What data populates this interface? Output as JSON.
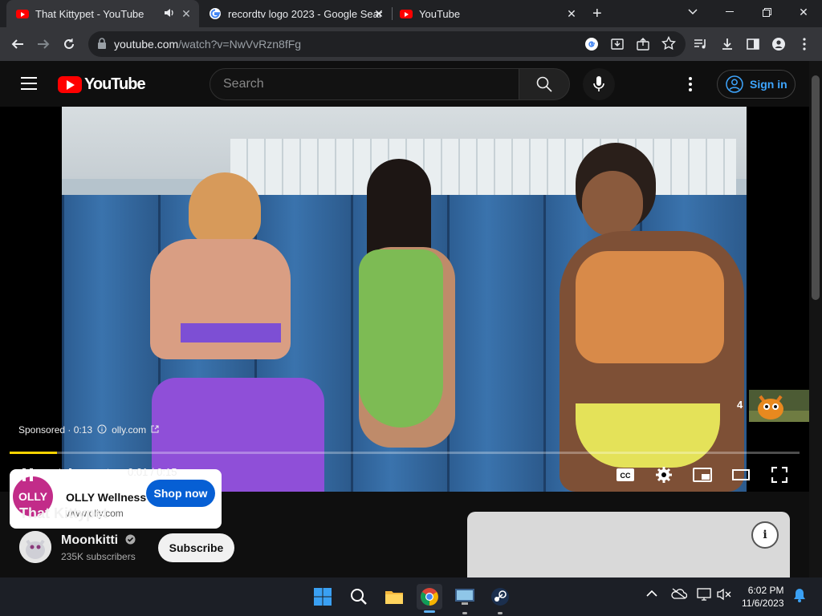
{
  "browser": {
    "tabs": [
      {
        "title": "That Kittypet - YouTube",
        "favicon": "youtube-icon",
        "active": true,
        "audio": true
      },
      {
        "title": "recordtv logo 2023 - Google Sear",
        "favicon": "google-icon",
        "active": false
      },
      {
        "title": "YouTube",
        "favicon": "youtube-icon",
        "active": false
      }
    ],
    "new_tab": "+",
    "url_host": "youtube.com",
    "url_path": "/watch?v=NwVvRzn8fFg"
  },
  "youtube": {
    "logo_text": "YouTube",
    "search_placeholder": "Search",
    "sign_in": "Sign in"
  },
  "player": {
    "ad": {
      "brand_initials": "OLLY",
      "name": "OLLY Wellness",
      "url": "www.olly.com",
      "cta": "Shop now",
      "sponsored": "Sponsored · 0:13",
      "domain": "olly.com"
    },
    "time": "0:01 / 0:15",
    "progress": 0.06,
    "upnext_count": "4"
  },
  "video": {
    "title": "That Kittypet",
    "channel": "Moonkitti",
    "subscribers": "235K subscribers",
    "subscribe": "Subscribe"
  },
  "taskbar": {
    "time": "6:02 PM",
    "date": "11/6/2023"
  },
  "colors": {
    "yt_red": "#ff0000",
    "link_blue": "#3ea6ff",
    "ad_button": "#065fd4",
    "progress": "#fdd400"
  }
}
